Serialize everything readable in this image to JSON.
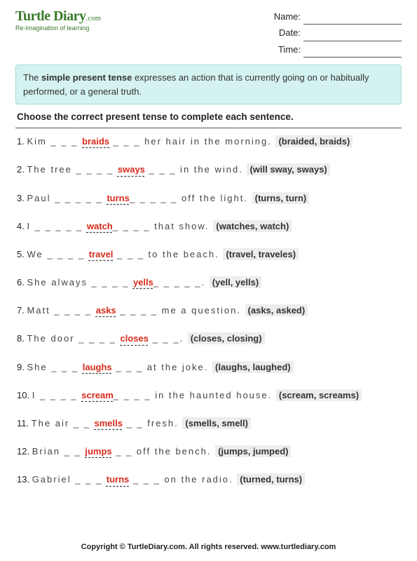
{
  "logo": {
    "main": "Turtle Diary",
    "suffix": ".com",
    "tagline": "Re-Imagination of learning"
  },
  "meta": {
    "name_label": "Name:",
    "date_label": "Date:",
    "time_label": "Time:"
  },
  "intro": {
    "pre": "The ",
    "bold": "simple present tense",
    "post": " expresses an action that is currently going on or habitually performed, or a general truth."
  },
  "instruction": "Choose the correct present tense to complete each sentence.",
  "questions": [
    {
      "n": "1.",
      "pre": "Kim _ _ _ ",
      "ans": "braids",
      "post": " _ _ _ her hair in the morning.  ",
      "opts": "(braided, braids)"
    },
    {
      "n": "2.",
      "pre": "The tree _ _ _ _ ",
      "ans": "sways",
      "post": " _ _ _ in the wind.  ",
      "opts": "(will sway, sways)"
    },
    {
      "n": "3.",
      "pre": "Paul _ _ _ _ _ ",
      "ans": "turns",
      "post": "_ _ _ _ _ off the light.  ",
      "opts": "(turns, turn)"
    },
    {
      "n": "4.",
      "pre": "I _ _ _ _ _ ",
      "ans": "watch",
      "post": "_ _ _ _ that show.  ",
      "opts": "(watches, watch)"
    },
    {
      "n": "5.",
      "pre": "We _ _ _ _ ",
      "ans": "travel",
      "post": " _ _ _ to the beach.  ",
      "opts": "(travel, traveles)"
    },
    {
      "n": "6.",
      "pre": "She always _ _ _ _ ",
      "ans": "yells",
      "post": "_ _ _ _ _.  ",
      "opts": "(yell, yells)"
    },
    {
      "n": "7.",
      "pre": "Matt _ _ _ _ ",
      "ans": "asks",
      "post": " _ _ _ _ me a question.  ",
      "opts": "(asks, asked)"
    },
    {
      "n": "8.",
      "pre": "The door _ _ _ _ ",
      "ans": "closes",
      "post": " _ _ _.  ",
      "opts": "(closes, closing)"
    },
    {
      "n": "9.",
      "pre": "She _ _ _ ",
      "ans": "laughs",
      "post": " _ _ _ at the joke.  ",
      "opts": "(laughs, laughed)"
    },
    {
      "n": "10.",
      "pre": "I _ _ _ _ ",
      "ans": "scream",
      "post": "_ _ _ _ in the haunted house.  ",
      "opts": "(scream, screams)"
    },
    {
      "n": "11.",
      "pre": "The air _ _ ",
      "ans": "smells",
      "post": " _ _ fresh.  ",
      "opts": "(smells, smell)"
    },
    {
      "n": "12.",
      "pre": "Brian _ _ ",
      "ans": "jumps",
      "post": " _ _ off the bench.  ",
      "opts": "(jumps, jumped)"
    },
    {
      "n": "13.",
      "pre": "Gabriel _ _ _ ",
      "ans": "turns",
      "post": " _ _ _ on the radio.  ",
      "opts": "(turned, turns)"
    }
  ],
  "footer": "Copyright © TurtleDiary.com. All rights reserved. www.turtlediary.com"
}
